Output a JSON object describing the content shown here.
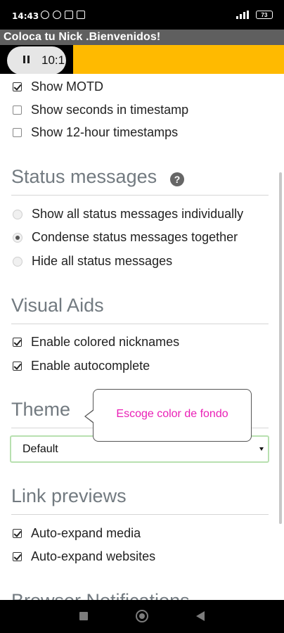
{
  "status_bar": {
    "time": "14:43",
    "battery": "73"
  },
  "banner": {
    "title": "Coloca tu Nick .Bienvenidos!"
  },
  "media": {
    "time": "10:1"
  },
  "settings": {
    "top_items": [
      {
        "label": "Show MOTD",
        "checked": true
      },
      {
        "label": "Show seconds in timestamp",
        "checked": false
      },
      {
        "label": "Show 12-hour timestamps",
        "checked": false
      }
    ],
    "status_messages": {
      "title": "Status messages",
      "help_icon": "?",
      "options": [
        {
          "label": "Show all status messages individually",
          "selected": false
        },
        {
          "label": "Condense status messages together",
          "selected": true
        },
        {
          "label": "Hide all status messages",
          "selected": false
        }
      ]
    },
    "visual_aids": {
      "title": "Visual Aids",
      "items": [
        {
          "label": "Enable colored nicknames",
          "checked": true
        },
        {
          "label": "Enable autocomplete",
          "checked": true
        }
      ]
    },
    "theme": {
      "title": "Theme",
      "selected": "Default",
      "tooltip": "Escoge color de fondo"
    },
    "link_previews": {
      "title": "Link previews",
      "items": [
        {
          "label": "Auto-expand media",
          "checked": true
        },
        {
          "label": "Auto-expand websites",
          "checked": true
        }
      ]
    },
    "browser_notifications": {
      "title": "Browser Notifications"
    }
  },
  "colors": {
    "banner_bg": "#5f5f5f",
    "media_bar": "#ffba00",
    "section_title": "#727a80",
    "tooltip_text": "#ea1fb6",
    "select_border": "#b8e0b0"
  }
}
